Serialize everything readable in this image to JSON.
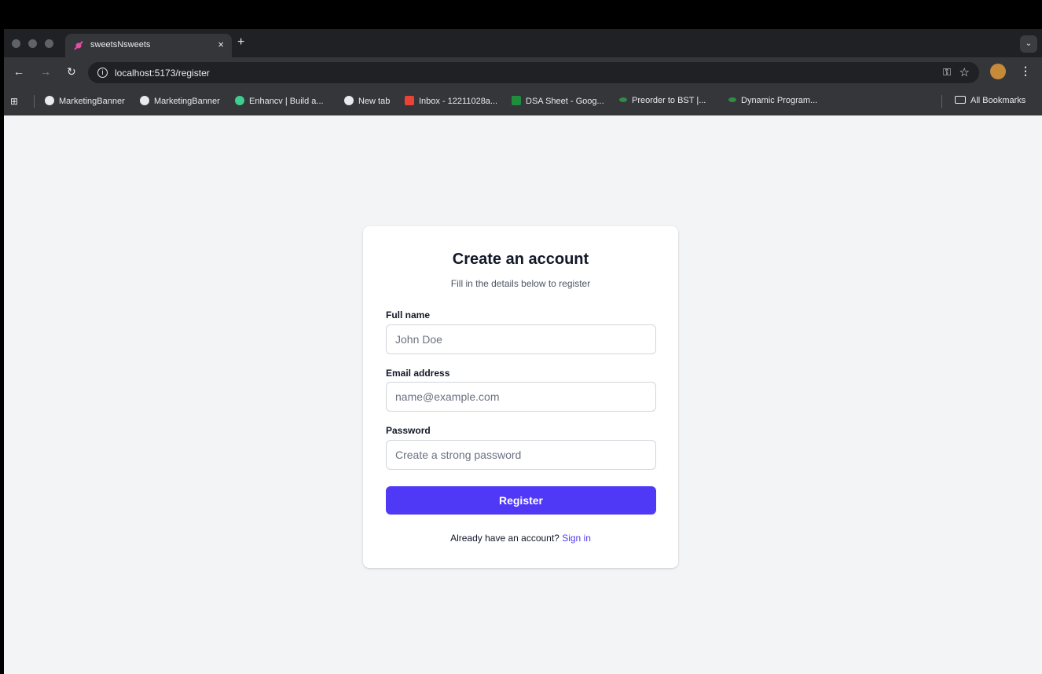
{
  "browser": {
    "tab_title": "sweetsNsweets",
    "tab_close": "×",
    "new_tab": "+",
    "url": "localhost:5173/register",
    "bookmarks": [
      {
        "label": "MarketingBanner",
        "icon": "globe-icon"
      },
      {
        "label": "MarketingBanner",
        "icon": "globe-icon"
      },
      {
        "label": "Enhancv | Build a...",
        "icon": "enhancv-icon"
      },
      {
        "label": "New tab",
        "icon": "globe-icon"
      },
      {
        "label": "Inbox - 12211028a...",
        "icon": "gmail-icon"
      },
      {
        "label": "DSA Sheet - Goog...",
        "icon": "sheets-icon"
      },
      {
        "label": "Preorder to BST |...",
        "icon": "gfg-icon"
      },
      {
        "label": "Dynamic Program...",
        "icon": "gfg-icon"
      }
    ],
    "all_bookmarks": "All Bookmarks"
  },
  "form": {
    "title": "Create an account",
    "subtitle": "Fill in the details below to register",
    "fields": {
      "name_label": "Full name",
      "name_placeholder": "John Doe",
      "email_label": "Email address",
      "email_placeholder": "name@example.com",
      "password_label": "Password",
      "password_placeholder": "Create a strong password"
    },
    "submit_label": "Register",
    "footer_text": "Already have an account?",
    "signin_label": "Sign in"
  },
  "colors": {
    "accent": "#4f39f6",
    "page_bg": "#f3f4f6"
  }
}
